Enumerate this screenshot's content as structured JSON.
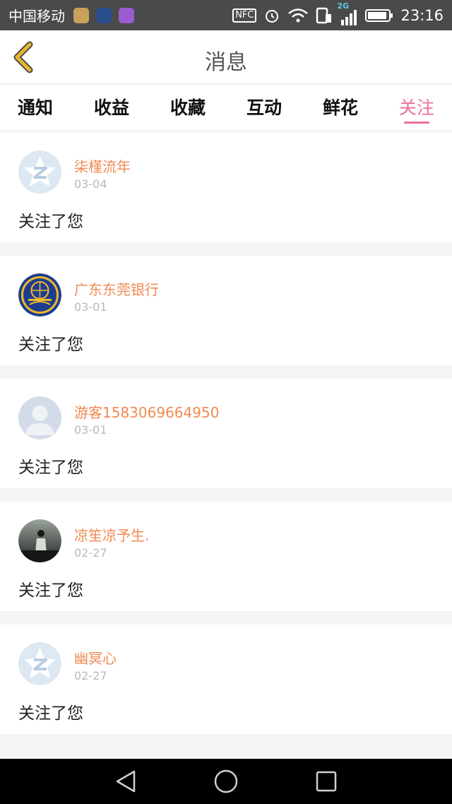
{
  "status_bar": {
    "carrier": "中国移动",
    "nfc": "NFC",
    "network": "2G",
    "time": "23:16"
  },
  "header": {
    "title": "消息"
  },
  "tabs": [
    {
      "label": "通知"
    },
    {
      "label": "收益"
    },
    {
      "label": "收藏"
    },
    {
      "label": "互动"
    },
    {
      "label": "鲜花"
    },
    {
      "label": "关注"
    }
  ],
  "active_tab": "关注",
  "colors": {
    "accent": "#ec6fa0",
    "username": "#f08a52",
    "date": "#b8b8b8",
    "back_icon": "#e7b72f"
  },
  "messages": [
    {
      "name": "柒槿流年",
      "date": "03-04",
      "text": "关注了您",
      "avatar": "default-qq-avatar"
    },
    {
      "name": "广东东莞银行",
      "date": "03-01",
      "text": "关注了您",
      "avatar": "team-logo-avatar"
    },
    {
      "name": "游客1583069664950",
      "date": "03-01",
      "text": "关注了您",
      "avatar": "guest-silhouette-avatar"
    },
    {
      "name": "凉笙凉予生.",
      "date": "02-27",
      "text": "关注了您",
      "avatar": "photo-avatar"
    },
    {
      "name": "幽冥心",
      "date": "02-27",
      "text": "关注了您",
      "avatar": "default-qq-avatar"
    }
  ]
}
